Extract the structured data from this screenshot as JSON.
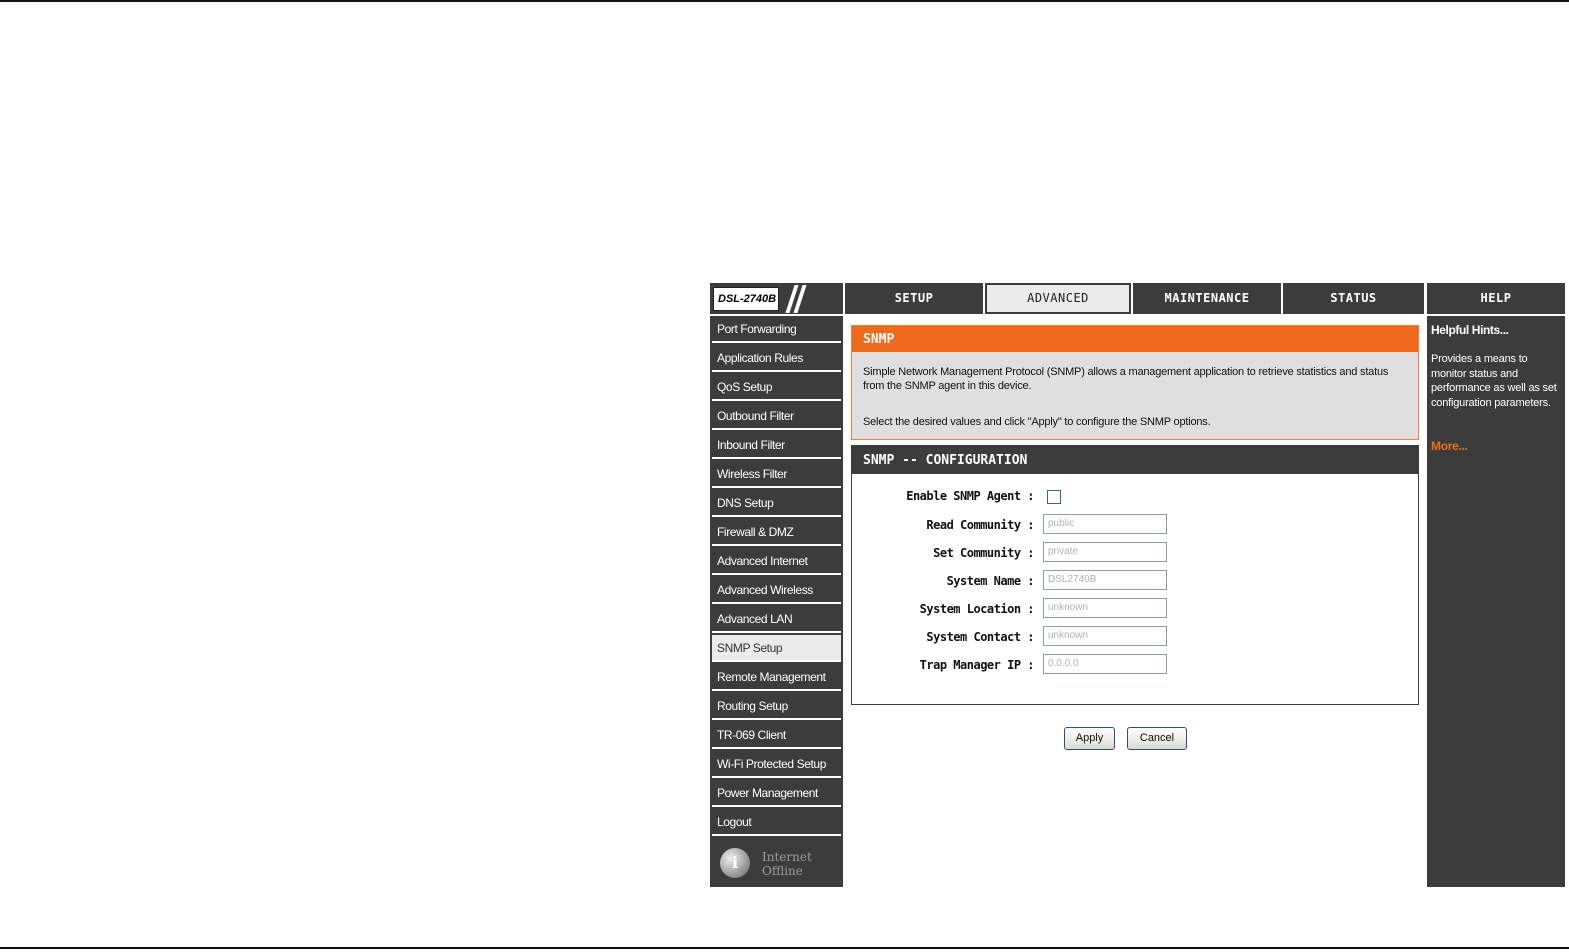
{
  "app": {
    "model": "DSL-2740B"
  },
  "tabs": [
    {
      "label": "SETUP",
      "active": false
    },
    {
      "label": "ADVANCED",
      "active": true
    },
    {
      "label": "MAINTENANCE",
      "active": false
    },
    {
      "label": "STATUS",
      "active": false
    },
    {
      "label": "HELP",
      "active": false
    }
  ],
  "sidebar": {
    "items": [
      {
        "label": "Port Forwarding"
      },
      {
        "label": "Application Rules"
      },
      {
        "label": "QoS Setup"
      },
      {
        "label": "Outbound Filter"
      },
      {
        "label": "Inbound Filter"
      },
      {
        "label": "Wireless Filter"
      },
      {
        "label": "DNS Setup"
      },
      {
        "label": "Firewall & DMZ"
      },
      {
        "label": "Advanced Internet"
      },
      {
        "label": "Advanced Wireless"
      },
      {
        "label": "Advanced LAN"
      },
      {
        "label": "SNMP Setup",
        "active": true
      },
      {
        "label": "Remote Management"
      },
      {
        "label": "Routing Setup"
      },
      {
        "label": "TR-069 Client"
      },
      {
        "label": "Wi-Fi Protected Setup"
      },
      {
        "label": "Power Management"
      },
      {
        "label": "Logout"
      }
    ],
    "status": {
      "icon": "info-globe-icon",
      "line1": "Internet",
      "line2": "Offline"
    }
  },
  "snmp": {
    "title": "SNMP",
    "description_line1": "Simple Network Management Protocol (SNMP) allows a management application to retrieve statistics and status",
    "description_line2": "from the SNMP agent in this device.",
    "instruction": "Select the desired values and click \"Apply\" to configure the SNMP options."
  },
  "config": {
    "title": "SNMP -- CONFIGURATION",
    "enable_label": "Enable SNMP Agent :",
    "enable_checked": false,
    "fields": [
      {
        "label": "Read Community :",
        "value": "public"
      },
      {
        "label": "Set Community :",
        "value": "private"
      },
      {
        "label": "System Name :",
        "value": "DSL2740B"
      },
      {
        "label": "System Location :",
        "value": "unknown"
      },
      {
        "label": "System Contact :",
        "value": "unknown"
      },
      {
        "label": "Trap Manager IP :",
        "value": "0.0.0.0"
      }
    ]
  },
  "buttons": {
    "apply": "Apply",
    "cancel": "Cancel"
  },
  "help": {
    "title": "Helpful Hints...",
    "text": "Provides a means to monitor status and performance as well as set configuration parameters.",
    "more": "More..."
  },
  "colors": {
    "accent": "#f06a1e",
    "dark": "#3c3c3c",
    "light": "#dfdfdf"
  }
}
